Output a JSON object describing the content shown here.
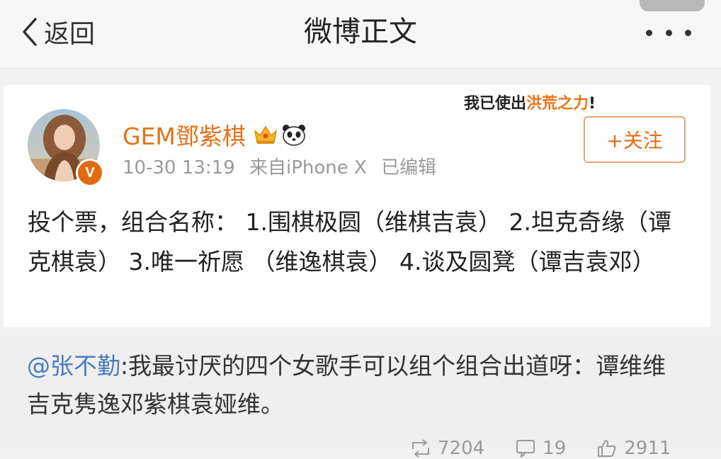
{
  "nav": {
    "back_label": "返回",
    "title": "微博正文",
    "back_icon": "chevron-left-icon",
    "more_icon": "more-dots-icon"
  },
  "post": {
    "username": "GEM鄧紫棋",
    "badges": [
      "crown-icon",
      "panda-icon"
    ],
    "verified_badge": "V",
    "time": "10-30 13:19",
    "source": "来自iPhone X",
    "edited": "已编辑",
    "follow_label": "+关注",
    "sticker_text": "我已使出",
    "sticker_highlight": "洪荒之力",
    "sticker_end": "!",
    "text": "投个票，组合名称： 1.围棋极圆（维棋吉袁） 2.坦克奇缘（谭克棋袁） 3.唯一祈愿 （维逸棋袁） 4.谈及圆凳（谭吉袁邓）"
  },
  "repost": {
    "mention": "@张不勤",
    "text": ":我最讨厌的四个女歌手可以组个组合出道呀：谭维维吉克隽逸邓紫棋袁娅维。"
  },
  "stats": {
    "reposts": "7204",
    "comments": "19",
    "likes": "2911"
  },
  "colors": {
    "accent": "#e47119",
    "link": "#4b7bbd",
    "verified": "#e06a0e"
  }
}
